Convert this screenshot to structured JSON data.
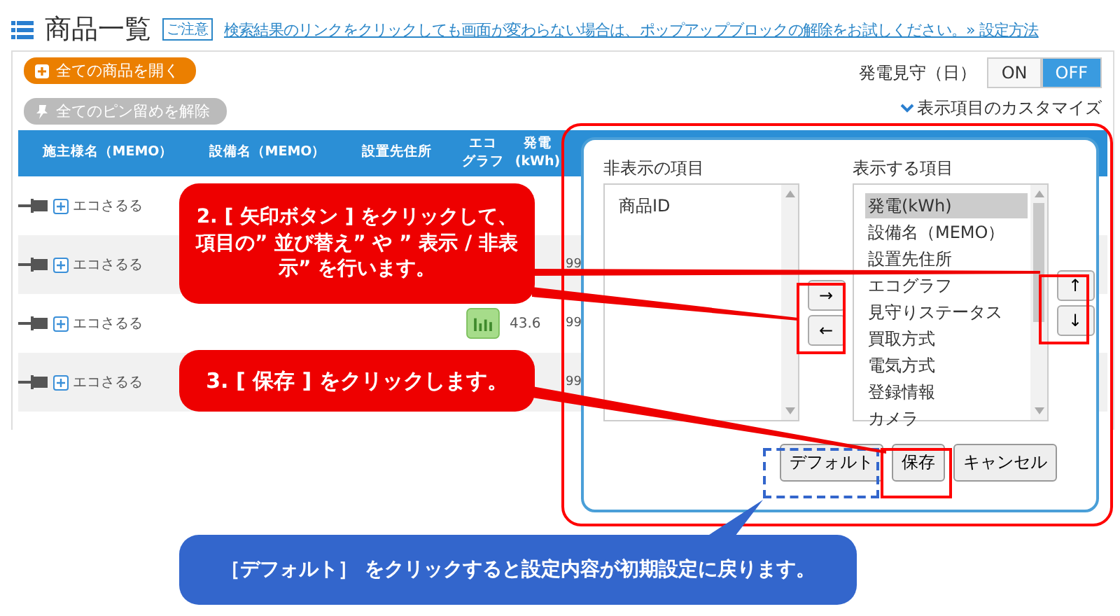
{
  "header": {
    "title": "商品一覧",
    "notice_tag": "ご注意",
    "notice_link": "検索結果のリンクをクリックしても画面が変わらない場合は、ポップアップブロックの解除をお試しください。» 設定方法"
  },
  "toolbar": {
    "open_all": "全ての商品を開く",
    "unpin_all": "全てのピン留めを解除",
    "monitor_label": "発電見守（日）",
    "toggle": [
      {
        "label": "ON",
        "selected": false
      },
      {
        "label": "OFF",
        "selected": true
      }
    ],
    "customize_link": "表示項目のカスタマイズ"
  },
  "table": {
    "columns": [
      [
        "施主様名（MEMO）"
      ],
      [
        "設備名（MEMO）"
      ],
      [
        "設置先住所"
      ],
      [
        "エコ",
        "グラフ"
      ],
      [
        "発電",
        "(kWh)"
      ]
    ],
    "rows": [
      {
        "name": "エコさるる",
        "generation": "",
        "column_6": ""
      },
      {
        "name": "エコさるる",
        "generation": "",
        "column_6": "99"
      },
      {
        "name": "エコさるる",
        "graph": true,
        "generation": "43.6",
        "column_6": "99"
      },
      {
        "name": "エコさるる",
        "generation": "",
        "column_6": "99"
      }
    ]
  },
  "dialog": {
    "hidden_title": "非表示の項目",
    "hidden_items": [
      {
        "label": "商品ID",
        "selected": false
      }
    ],
    "shown_title": "表示する項目",
    "shown_items": [
      {
        "label": "発電(kWh)",
        "selected": true
      },
      {
        "label": "設備名（MEMO）",
        "selected": false
      },
      {
        "label": "設置先住所",
        "selected": false
      },
      {
        "label": "エコグラフ",
        "selected": false
      },
      {
        "label": "見守りステータス",
        "selected": false
      },
      {
        "label": "買取方式",
        "selected": false
      },
      {
        "label": "電気方式",
        "selected": false
      },
      {
        "label": "登録情報",
        "selected": false
      },
      {
        "label": "カメラ",
        "selected": false
      }
    ],
    "move_buttons": [
      "→",
      "←"
    ],
    "order_buttons": [
      "↑",
      "↓"
    ],
    "buttons": [
      "デフォルト",
      "保存",
      "キャンセル"
    ]
  },
  "callouts": [
    {
      "kind": "red",
      "text": "2. [ 矢印ボタン ] をクリックして、項目の” 並び替え” や ” 表示 / 非表示” を行います。"
    },
    {
      "kind": "red",
      "text": "3. [ 保存 ] をクリックします。"
    },
    {
      "kind": "blue",
      "text": "［デフォルト］ をクリックすると設定内容が初期設定に戻ります。"
    }
  ]
}
